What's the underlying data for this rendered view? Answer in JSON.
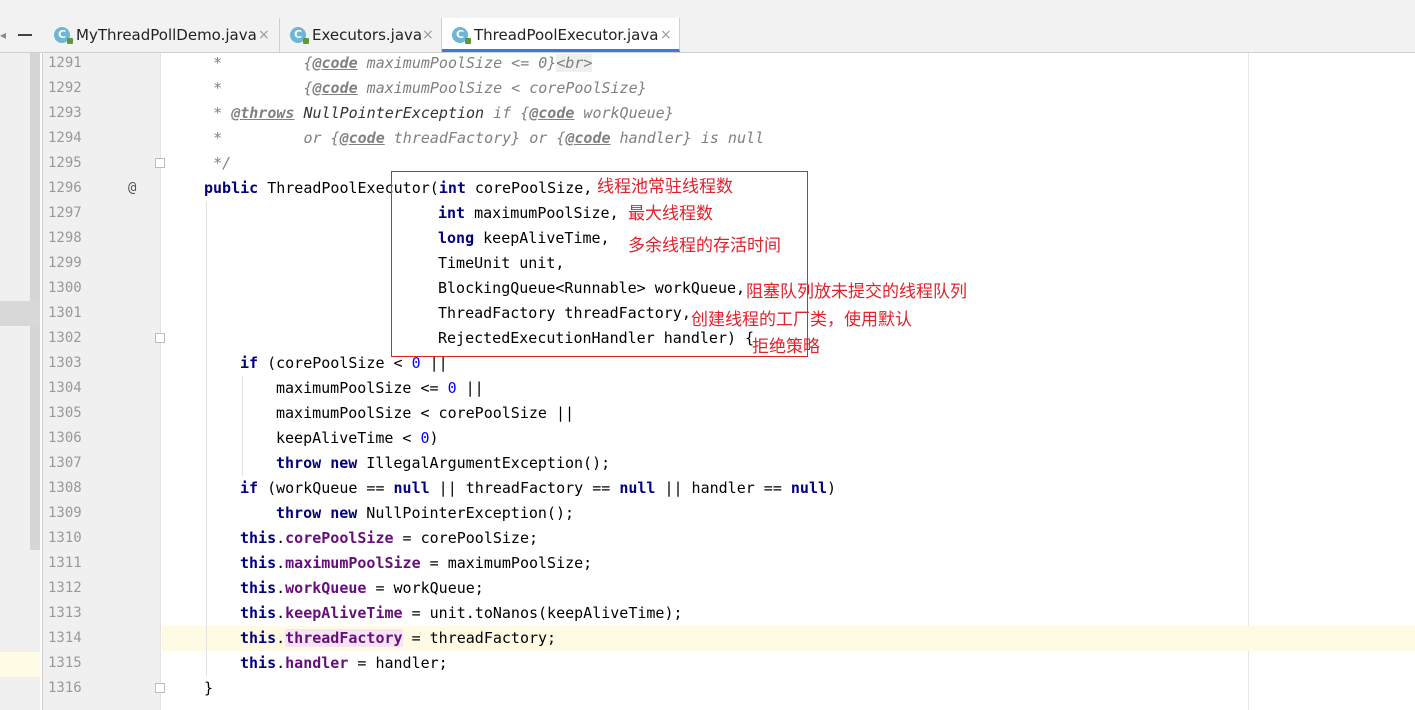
{
  "tabs": [
    {
      "label": "MyThreadPollDemo.java",
      "icon": "java-class-icon",
      "close": "×",
      "active": false
    },
    {
      "label": "Executors.java",
      "icon": "java-class-icon",
      "close": "×",
      "active": false
    },
    {
      "label": "ThreadPoolExecutor.java",
      "icon": "java-class-icon",
      "close": "×",
      "active": true
    }
  ],
  "left_controls": {
    "caret": "◂",
    "minimize": "—"
  },
  "gutter": {
    "override_marker": "@"
  },
  "line_numbers": [
    "1291",
    "1292",
    "1293",
    "1294",
    "1295",
    "1296",
    "1297",
    "1298",
    "1299",
    "1300",
    "1301",
    "1302",
    "1303",
    "1304",
    "1305",
    "1306",
    "1307",
    "1308",
    "1309",
    "1310",
    "1311",
    "1312",
    "1313",
    "1314",
    "1315",
    "1316"
  ],
  "code": {
    "l1291": {
      "a": "     *         {",
      "b": "@code",
      "c": " maximumPoolSize <= 0}",
      "d": "<br>"
    },
    "l1292": {
      "a": "     *         {",
      "b": "@code",
      "c": " maximumPoolSize < corePoolSize}"
    },
    "l1293": {
      "a": "     * ",
      "b": "@throws",
      "c": " NullPointerException",
      "d": " if {",
      "e": "@code",
      "f": " workQueue}"
    },
    "l1294": {
      "a": "     *         or {",
      "b": "@code",
      "c": " threadFactory} or {",
      "d": "@code",
      "e": " handler} is null"
    },
    "l1295": {
      "a": "     */"
    },
    "l1296": {
      "kw1": "public",
      "a": " ThreadPoolExecutor(",
      "kw2": "int",
      "b": " corePoolSize,"
    },
    "l1297": {
      "kw": "int",
      "a": " maximumPoolSize,"
    },
    "l1298": {
      "kw": "long",
      "a": " keepAliveTime,"
    },
    "l1299": {
      "a": "TimeUnit unit,"
    },
    "l1300": {
      "a": "BlockingQueue<Runnable> workQueue,"
    },
    "l1301": {
      "a": "ThreadFactory threadFactory,"
    },
    "l1302": {
      "a": "RejectedExecutionHandler handler) {"
    },
    "l1303": {
      "kw": "if",
      "a": " (corePoolSize < ",
      "n": "0",
      "b": " ||"
    },
    "l1304": {
      "a": "maximumPoolSize <= ",
      "n": "0",
      "b": " ||"
    },
    "l1305": {
      "a": "maximumPoolSize < corePoolSize ||"
    },
    "l1306": {
      "a": "keepAliveTime < ",
      "n": "0",
      "b": ")"
    },
    "l1307": {
      "kw1": "throw",
      "sp": " ",
      "kw2": "new",
      "a": " IllegalArgumentException();"
    },
    "l1308": {
      "kw1": "if",
      "a": " (workQueue == ",
      "kw2": "null",
      "b": " || threadFactory == ",
      "kw3": "null",
      "c": " || handler == ",
      "kw4": "null",
      "d": ")"
    },
    "l1309": {
      "kw1": "throw",
      "sp": " ",
      "kw2": "new",
      "a": " NullPointerException();"
    },
    "l1310": {
      "kw": "this",
      "dot": ".",
      "f": "corePoolSize",
      "a": " = corePoolSize;"
    },
    "l1311": {
      "kw": "this",
      "dot": ".",
      "f": "maximumPoolSize",
      "a": " = maximumPoolSize;"
    },
    "l1312": {
      "kw": "this",
      "dot": ".",
      "f": "workQueue",
      "a": " = workQueue;"
    },
    "l1313": {
      "kw": "this",
      "dot": ".",
      "f": "keepAliveTime",
      "a": " = unit.toNanos(keepAliveTime);"
    },
    "l1314": {
      "kw": "this",
      "dot": ".",
      "f": "threadFactory",
      "a": " = threadFactory;"
    },
    "l1315": {
      "kw": "this",
      "dot": ".",
      "f": "handler",
      "a": " = handler;"
    },
    "l1316": {
      "a": "}"
    }
  },
  "annotations": {
    "core": "线程池常驻线程数",
    "max": "最大线程数",
    "keepalive": "多余线程的存活时间",
    "queue": "阻塞队列放未提交的线程队列",
    "factory": "创建线程的工厂类，使用默认",
    "reject": "拒绝策略"
  },
  "colors": {
    "annotation": "#e0222a",
    "keyword": "#000080",
    "field": "#660e7a",
    "number": "#0000ff",
    "comment": "#808080",
    "active_tab_underline": "#3c7ad8"
  }
}
